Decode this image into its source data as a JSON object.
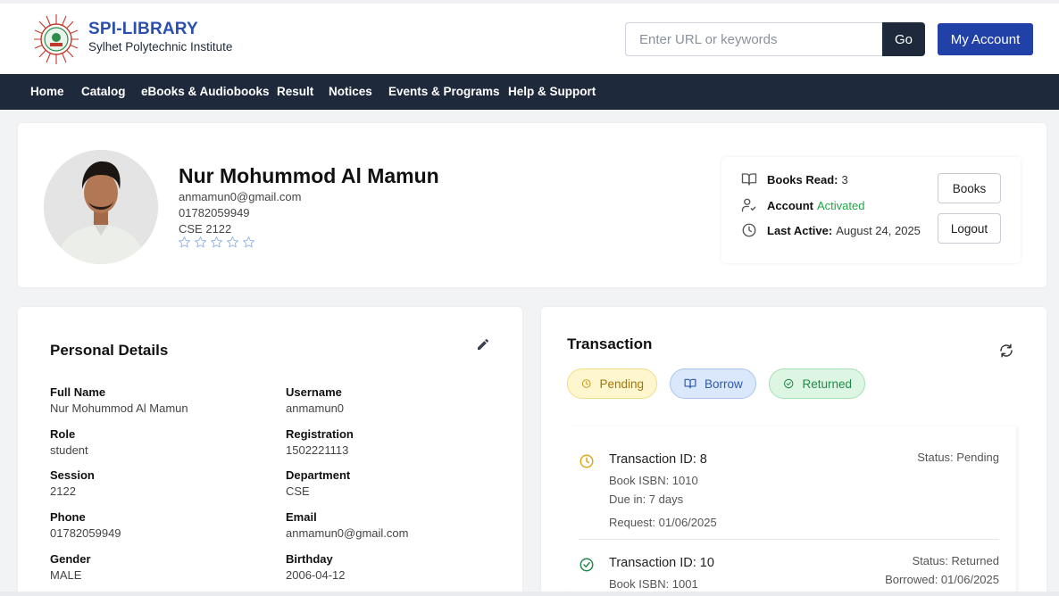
{
  "brand": {
    "title": "SPI-LIBRARY",
    "subtitle": "Sylhet Polytechnic Institute"
  },
  "search": {
    "placeholder": "Enter URL or keywords",
    "value": "",
    "go_label": "Go"
  },
  "header": {
    "account_label": "My Account"
  },
  "nav": [
    "Home",
    "Catalog",
    "eBooks & Audiobooks",
    "Result",
    "Notices",
    "Events & Programs",
    "Help & Support"
  ],
  "profile": {
    "name": "Nur Mohummod Al Mamun",
    "email": "anmamun0@gmail.com",
    "phone": "01782059949",
    "dept_session": "CSE 2122",
    "rating": 0,
    "rating_max": 5,
    "stats": {
      "books_read_label": "Books Read:",
      "books_read_value": "3",
      "account_label": "Account",
      "account_value": "Activated",
      "last_active_label": "Last Active:",
      "last_active_value": "August 24, 2025"
    },
    "buttons": {
      "books": "Books",
      "logout": "Logout"
    }
  },
  "personal": {
    "title": "Personal Details",
    "fields": [
      {
        "label": "Full Name",
        "value": "Nur Mohummod Al Mamun"
      },
      {
        "label": "Username",
        "value": "anmamun0"
      },
      {
        "label": "Role",
        "value": "student"
      },
      {
        "label": "Registration",
        "value": "1502221113"
      },
      {
        "label": "Session",
        "value": "2122"
      },
      {
        "label": "Department",
        "value": "CSE"
      },
      {
        "label": "Phone",
        "value": "01782059949"
      },
      {
        "label": "Email",
        "value": "anmamun0@gmail.com"
      },
      {
        "label": "Gender",
        "value": "MALE"
      },
      {
        "label": "Birthday",
        "value": "2006-04-12"
      }
    ]
  },
  "transaction": {
    "title": "Transaction",
    "filters": [
      "Pending",
      "Borrow",
      "Returned"
    ],
    "items": [
      {
        "id": "Transaction ID: 8",
        "isbn": "Book ISBN: 1010",
        "due": "Due in: 7 days",
        "date": "Request: 01/06/2025",
        "status": "Status: Pending",
        "status_icon": "clock-icon"
      },
      {
        "id": "Transaction ID: 10",
        "isbn": "Book ISBN: 1001",
        "status": "Status: Returned",
        "date": "Borrowed: 01/06/2025",
        "status_icon": "check-circle-icon"
      }
    ]
  },
  "colors": {
    "brand_blue": "#2a4fb0",
    "nav_bg": "#1e293b",
    "account_btn": "#2140a8",
    "activated_green": "#22a447",
    "pending_yellow": "#e0a81a",
    "returned_green": "#23894a"
  }
}
